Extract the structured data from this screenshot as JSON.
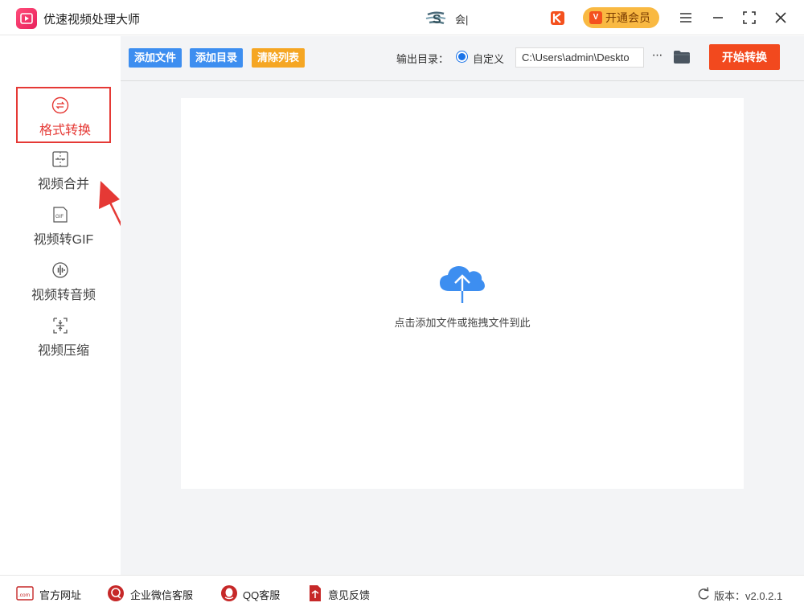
{
  "app": {
    "title": "优速视频处理大师"
  },
  "user": {
    "name": "会|"
  },
  "header": {
    "vip_badge": "V",
    "vip_label": "开通会员"
  },
  "sidebar": {
    "items": [
      {
        "label": "格式转换",
        "icon": "format-convert-icon",
        "active": true
      },
      {
        "label": "视频合并",
        "icon": "merge-icon"
      },
      {
        "label": "视频转GIF",
        "icon": "gif-icon"
      },
      {
        "label": "视频转音频",
        "icon": "audio-icon"
      },
      {
        "label": "视频压缩",
        "icon": "compress-icon"
      }
    ]
  },
  "toolbar": {
    "add_file": "添加文件",
    "add_dir": "添加目录",
    "clear_list": "清除列表",
    "output_label": "输出目录：",
    "custom_label": "自定义",
    "path_value": "C:\\Users\\admin\\Deskto",
    "more": "···",
    "start": "开始转换"
  },
  "dropzone": {
    "hint": "点击添加文件或拖拽文件到此"
  },
  "footer": {
    "website": "官方网址",
    "website_icon_text": ".com",
    "wechat": "企业微信客服",
    "qq": "QQ客服",
    "feedback": "意见反馈",
    "version": "版本：v2.0.2.1"
  },
  "colors": {
    "accent": "#f2491e",
    "blue": "#3d8ef0",
    "orange": "#f5a623",
    "active_red": "#e53935",
    "vip": "#f9b942"
  }
}
